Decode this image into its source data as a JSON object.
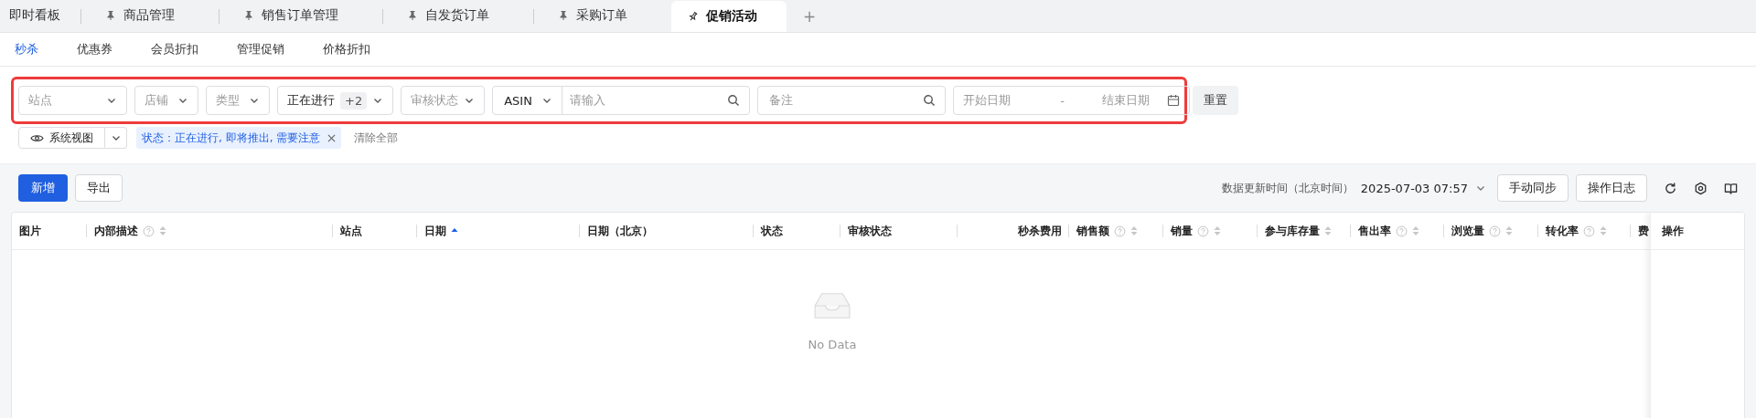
{
  "tabs": [
    {
      "label": "即时看板",
      "pinned": false,
      "selected": false
    },
    {
      "label": "商品管理",
      "pinned": true,
      "selected": false
    },
    {
      "label": "销售订单管理",
      "pinned": true,
      "selected": false
    },
    {
      "label": "自发货订单",
      "pinned": true,
      "selected": false
    },
    {
      "label": "采购订单",
      "pinned": true,
      "selected": false
    },
    {
      "label": "促销活动",
      "pinned": true,
      "selected": true
    }
  ],
  "add_tab": "+",
  "subtabs": [
    {
      "label": "秒杀",
      "selected": true
    },
    {
      "label": "优惠券",
      "selected": false
    },
    {
      "label": "会员折扣",
      "selected": false
    },
    {
      "label": "管理促销",
      "selected": false
    },
    {
      "label": "价格折扣",
      "selected": false
    }
  ],
  "filters": [
    {
      "kind": "select",
      "placeholder": "站点"
    },
    {
      "kind": "select",
      "placeholder": "店铺"
    },
    {
      "kind": "select",
      "placeholder": "类型"
    },
    {
      "kind": "select",
      "value": "正在进行",
      "count": "+2"
    },
    {
      "kind": "select",
      "placeholder": "审核状态"
    },
    {
      "kind": "search",
      "value": "ASIN",
      "placeholder": "请输入"
    },
    {
      "kind": "search",
      "placeholder": "备注"
    },
    {
      "kind": "daterange",
      "start_placeholder": "开始日期",
      "separator": "-",
      "end_placeholder": "结束日期"
    }
  ],
  "reset_button": "重置",
  "view_button": "系统视图",
  "active_filter": "状态：正在进行, 即将推出, 需要注意",
  "clear_all": "清除全部",
  "toolbar": {
    "add_button": "新增",
    "export_button": "导出",
    "update_label": "数据更新时间（北京时间）",
    "update_time": "2025-07-03 07:57",
    "sync_button": "手动同步",
    "log_button": "操作日志"
  },
  "table": {
    "columns": [
      {
        "label": "图片",
        "help": false,
        "sortable": false,
        "sorted": false
      },
      {
        "label": "内部描述",
        "help": true,
        "sortable": true,
        "sorted": false
      },
      {
        "label": "站点",
        "help": false,
        "sortable": false,
        "sorted": false
      },
      {
        "label": "日期",
        "help": false,
        "sortable": true,
        "sorted": true
      },
      {
        "label": "日期（北京）",
        "help": false,
        "sortable": false,
        "sorted": false
      },
      {
        "label": "状态",
        "help": false,
        "sortable": false,
        "sorted": false
      },
      {
        "label": "审核状态",
        "help": false,
        "sortable": false,
        "sorted": false
      },
      {
        "label": "秒杀费用",
        "help": false,
        "sortable": false,
        "sorted": false
      },
      {
        "label": "销售额",
        "help": true,
        "sortable": true,
        "sorted": false
      },
      {
        "label": "销量",
        "help": true,
        "sortable": true,
        "sorted": false
      },
      {
        "label": "参与库存量",
        "help": false,
        "sortable": true,
        "sorted": false
      },
      {
        "label": "售出率",
        "help": true,
        "sortable": true,
        "sorted": false
      },
      {
        "label": "浏览量",
        "help": true,
        "sortable": true,
        "sorted": false
      },
      {
        "label": "转化率",
        "help": true,
        "sortable": true,
        "sorted": false
      },
      {
        "label": "费"
      }
    ],
    "fixed_column": "操作",
    "empty_text": "No Data"
  }
}
